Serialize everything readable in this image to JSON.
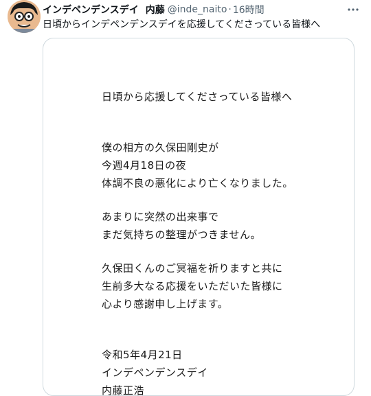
{
  "tweet": {
    "display_name": "インデペンデンスデイ",
    "display_name_suffix": "内藤",
    "handle": "@inde_naito",
    "separator": "·",
    "time": "16時間",
    "text": "日頃からインデペンデンスデイを応援してくださっている皆様へ",
    "more_icon": "more-horizontal-icon",
    "avatar_icon": "cartoon-face-avatar"
  },
  "letter": {
    "salutation": "日頃から応援してくださっている皆様へ",
    "p1": [
      "僕の相方の久保田剛史が",
      "今週4月18日の夜",
      "体調不良の悪化により亡くなりました。"
    ],
    "p2": [
      "あまりに突然の出来事で",
      "まだ気持ちの整理がつきません。"
    ],
    "p3": [
      "久保田くんのご冥福を祈りますと共に",
      "生前多大なる応援をいただいた皆様に",
      "心より感謝申し上げます。"
    ],
    "sign": [
      "令和5年4月21日",
      "インデペンデンスデイ",
      "内藤正浩"
    ]
  },
  "colors": {
    "text": "#0f1419",
    "secondary": "#536471",
    "border": "#cfd9de"
  }
}
